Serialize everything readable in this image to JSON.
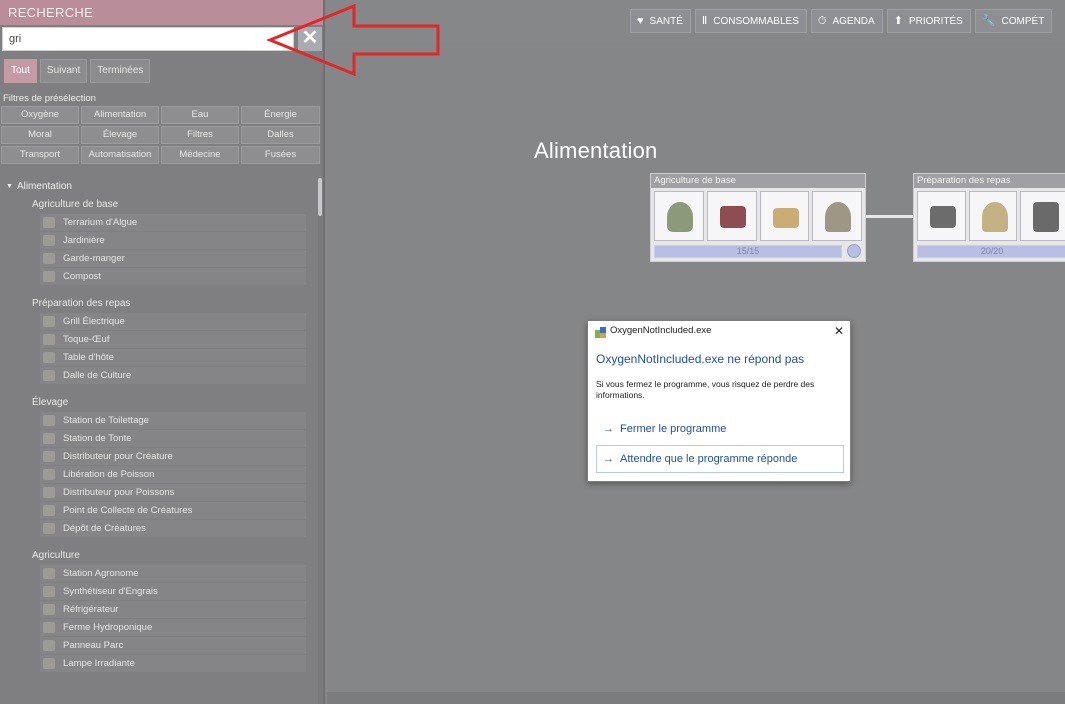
{
  "search_panel": {
    "title": "RECHERCHE",
    "search_value": "gri",
    "clear_label": "✕",
    "filter_tabs": [
      "Tout",
      "Suivant",
      "Terminées"
    ],
    "presets_title": "Filtres de présélection",
    "presets": [
      "Oxygène",
      "Alimentation",
      "Eau",
      "Énergie",
      "Moral",
      "Élevage",
      "Filtres",
      "Dalles",
      "Transport",
      "Automatisation",
      "Médecine",
      "Fusées"
    ],
    "tree": {
      "category": "Alimentation",
      "groups": [
        {
          "title": "Agriculture de base",
          "items": [
            "Terrarium d'Algue",
            "Jardinière",
            "Garde-manger",
            "Compost"
          ]
        },
        {
          "title": "Préparation des repas",
          "items": [
            "Grill Électrique",
            "Toque-Œuf",
            "Table d'hôte",
            "Dalle de Culture"
          ]
        },
        {
          "title": "Élevage",
          "items": [
            "Station de Toilettage",
            "Station de Tonte",
            "Distributeur pour Créature",
            "Libération de Poisson",
            "Distributeur pour Poissons",
            "Point de Collecte de Créatures",
            "Dépôt de Créatures"
          ]
        },
        {
          "title": "Agriculture",
          "items": [
            "Station Agronome",
            "Synthétiseur d'Engrais",
            "Réfrigérateur",
            "Ferme Hydroponique",
            "Panneau Parc",
            "Lampe Irradiante"
          ]
        }
      ]
    }
  },
  "toolbar": {
    "buttons": [
      {
        "label": "SANTÉ",
        "icon": "heart-icon"
      },
      {
        "label": "CONSOMMABLES",
        "icon": "cutlery-icon"
      },
      {
        "label": "AGENDA",
        "icon": "stopwatch-icon"
      },
      {
        "label": "PRIORITÉS",
        "icon": "priority-icon"
      },
      {
        "label": "COMPÉT",
        "icon": "wrench-icon"
      }
    ]
  },
  "research_view": {
    "section_title": "Alimentation",
    "techs": [
      {
        "name": "Agriculture de base",
        "progress": "15/15"
      },
      {
        "name": "Préparation des repas",
        "progress": "20/20"
      }
    ]
  },
  "dialog": {
    "title": "OxygenNotIncluded.exe",
    "heading": "OxygenNotIncluded.exe ne répond pas",
    "message": "Si vous fermez le programme, vous risquez de perdre des informations.",
    "options": [
      "Fermer le programme",
      "Attendre que le programme réponde"
    ]
  },
  "colors": {
    "header_pink": "#b98d99",
    "active_tab": "#c49aa5",
    "panel_bg": "#7f7f81",
    "dialog_link": "#1f4fa0",
    "annotation_arrow": "#e32626"
  }
}
